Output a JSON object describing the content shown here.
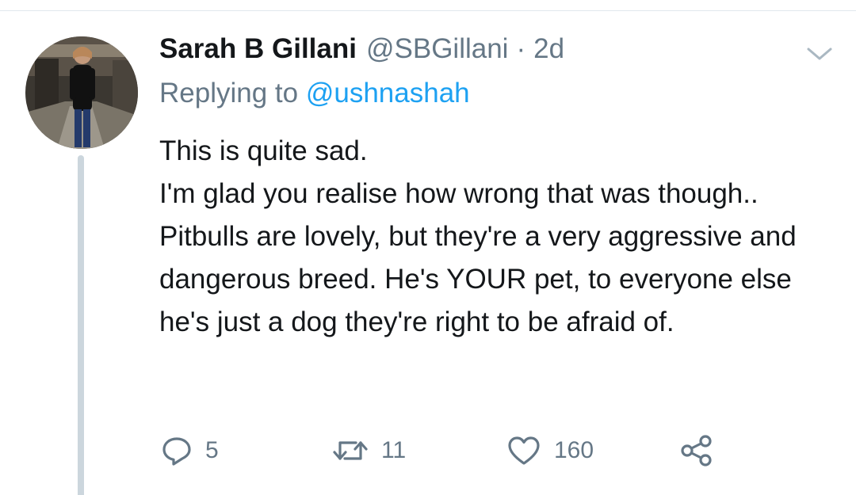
{
  "tweet": {
    "author_name": "Sarah B Gillani",
    "handle": "@SBGillani",
    "separator": "·",
    "timestamp": "2d",
    "replying_prefix": "Replying to",
    "replying_to": "@ushnashah",
    "body_lines": [
      "This is quite sad.",
      "I'm glad you realise how wrong that was though.. Pitbulls are lovely, but they're a very aggressive and dangerous breed. He's YOUR pet, to everyone else he's just a dog they're right to be afraid of."
    ]
  },
  "actions": {
    "replies": "5",
    "retweets": "11",
    "likes": "160"
  },
  "icons": {
    "reply": "reply-icon",
    "retweet": "retweet-icon",
    "like": "heart-icon",
    "share": "share-icon",
    "menu": "chevron-down-icon"
  },
  "colors": {
    "text": "#14171a",
    "muted": "#657786",
    "link": "#1da1f2",
    "thread_line": "#ccd6dd"
  }
}
